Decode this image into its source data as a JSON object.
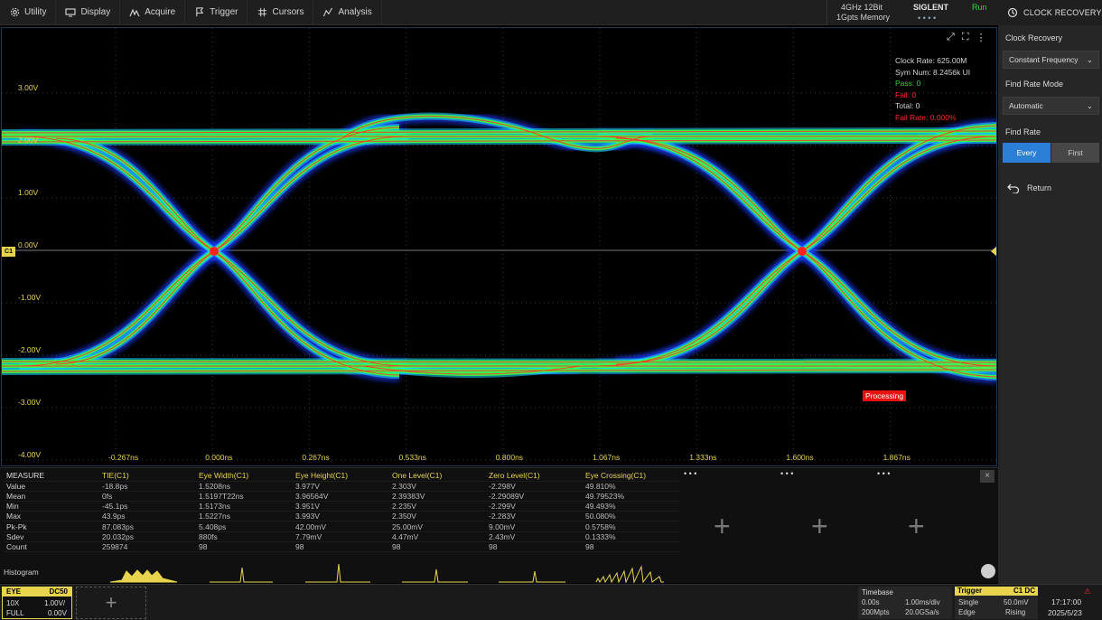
{
  "menu": [
    {
      "label": "Utility",
      "icon": "gear-icon"
    },
    {
      "label": "Display",
      "icon": "display-icon"
    },
    {
      "label": "Acquire",
      "icon": "acquire-icon"
    },
    {
      "label": "Trigger",
      "icon": "flag-icon"
    },
    {
      "label": "Cursors",
      "icon": "cursor-icon"
    },
    {
      "label": "Analysis",
      "icon": "analysis-icon"
    }
  ],
  "acq": {
    "bandwidth": "4GHz 12Bit",
    "memory": "1Gpts Memory",
    "brand": "SIGLENT",
    "status": "Run",
    "dots": "• • • •"
  },
  "panel": {
    "title": "CLOCK RECOVERY",
    "clock_recovery_label": "Clock Recovery",
    "clock_recovery_value": "Constant Frequency",
    "find_rate_mode_label": "Find Rate Mode",
    "find_rate_mode_value": "Automatic",
    "find_rate_label": "Find Rate",
    "find_rate_every": "Every",
    "find_rate_first": "First",
    "return_label": "Return"
  },
  "plot": {
    "y_ticks": [
      "3.00V",
      "2.00V",
      "1.00V",
      "0.00V",
      "-1.00V",
      "-2.00V",
      "-3.00V",
      "-4.00V"
    ],
    "x_ticks": [
      "-0.267ns",
      "0.000ns",
      "0.267ns",
      "0.533ns",
      "0.800ns",
      "1.067ns",
      "1.333ns",
      "1.600ns",
      "1.867ns"
    ],
    "channel_marker": "C1",
    "stats": {
      "clock_rate": "Clock Rate: 625.00M",
      "sym_num": "Sym Num: 8.2456k UI",
      "pass": "Pass: 0",
      "fail": "Fail: 0",
      "total": "Total: 0",
      "fail_rate": "Fail Rate: 0.000%"
    },
    "processing": "Processing",
    "colors": {
      "eye_core": "#ff3030",
      "eye_mid": "#3cff3c",
      "eye_outer": "#1a3dff",
      "grid": "#3a3a3a",
      "accent": "#e8d44d"
    }
  },
  "measure": {
    "header": [
      "MEASURE",
      "TIE(C1)",
      "Eye Width(C1)",
      "Eye Height(C1)",
      "One Level(C1)",
      "Zero Level(C1)",
      "Eye Crossing(C1)"
    ],
    "rows": [
      [
        "Value",
        "-18.8ps",
        "1.5208ns",
        "3.977V",
        "2.303V",
        "-2.298V",
        "49.810%"
      ],
      [
        "Mean",
        "0fs",
        "1.5197T22ns",
        "3.96564V",
        "2.39383V",
        "-2.29089V",
        "49.79523%"
      ],
      [
        "Min",
        "-45.1ps",
        "1.5173ns",
        "3.951V",
        "2.235V",
        "-2.299V",
        "49.493%"
      ],
      [
        "Max",
        "43.9ps",
        "1.5227ns",
        "3.993V",
        "2.350V",
        "-2.283V",
        "50.080%"
      ],
      [
        "Pk-Pk",
        "87.083ps",
        "5.408ps",
        "42.00mV",
        "25.00mV",
        "9.00mV",
        "0.5758%"
      ],
      [
        "Sdev",
        "20.032ps",
        "880fs",
        "7.79mV",
        "4.47mV",
        "2.43mV",
        "0.1333%"
      ],
      [
        "Count",
        "259874",
        "98",
        "98",
        "98",
        "98",
        "98"
      ]
    ],
    "extra_tabs": [
      "• • •",
      "• • •",
      "• • •"
    ],
    "histogram_label": "Histogram"
  },
  "bottom": {
    "ch1_label": "EYE",
    "ch1_coupling": "DC50",
    "ch1_probe": "10X",
    "ch1_scale": "1.00V/",
    "ch1_bw": "FULL",
    "ch1_offset": "0.00V",
    "timebase_label": "Timebase",
    "timebase_val1": "0.00s",
    "timebase_val2": "1.00ms/div",
    "timebase_val3": "200Mpts",
    "timebase_val4": "20.0GSa/s",
    "trigger_label": "Trigger",
    "trigger_coupling": "C1 DC",
    "trigger_mode": "Single",
    "trigger_level": "50.0mV",
    "trigger_type": "Edge",
    "trigger_slope": "Rising",
    "time": "17:17:00",
    "date": "2025/5/23"
  }
}
